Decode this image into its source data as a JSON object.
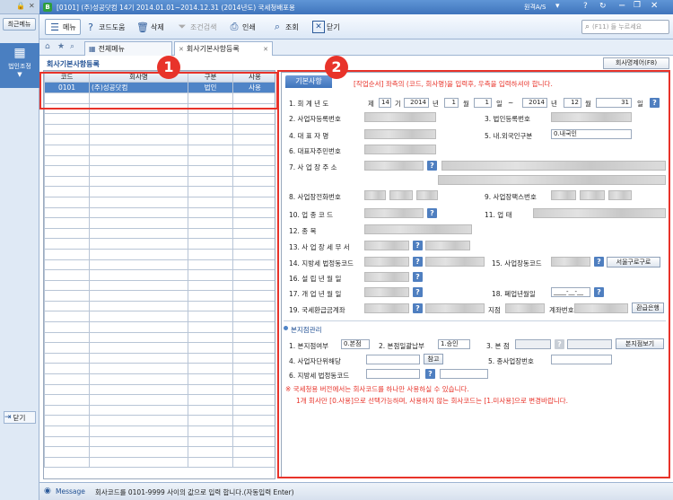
{
  "sidebar": {
    "recent_menu": "최근메뉴",
    "module_label": "법인조정",
    "close_label": "닫기"
  },
  "titlebar": {
    "title": "[0101] (주)성공닷컴  14기 2014.01.01~2014.12.31 (2014년도)  국세청배포용",
    "remote": "원격A/S"
  },
  "toolbar": {
    "menu": "메뉴",
    "help": "코드도움",
    "delete": "삭제",
    "condition": "조건검색",
    "print": "인쇄",
    "search": "조회",
    "close": "닫기",
    "search_placeholder": "(F11) 들 누르세요"
  },
  "tabs": {
    "all_menu": "전체메뉴",
    "current": "회사기본사항등록"
  },
  "page": {
    "section_title": "회사기본사항등록",
    "biz_list_button": "회사명제어(F8)"
  },
  "grid": {
    "headers": [
      "코드",
      "회사명",
      "구분",
      "사용"
    ],
    "rows": [
      {
        "code": "0101",
        "name": "(주)성공닷컴",
        "type": "법인",
        "use": "사용"
      }
    ]
  },
  "badges": {
    "one": "1",
    "two": "2"
  },
  "form": {
    "tab_label": "기본사항",
    "instruction": "[작업순서] 좌측의 (코드, 회사명)을 입력후, 우측을 입력하셔야 합니다.",
    "f1": {
      "label": "1. 회 계 년 도",
      "prefix": "제",
      "term": "14",
      "gi": "기",
      "y1": "2014",
      "nyeon": "년",
      "m1": "1",
      "wol": "월",
      "d1": "1",
      "il": "일",
      "tilde": "~",
      "y2": "2014",
      "m2": "12",
      "d2": "31"
    },
    "f2": "2. 사업자등록번호",
    "f3": "3. 법인등록번호",
    "f4": "4. 대 표 자 명",
    "f5": {
      "label": "5. 내.외국인구분",
      "value": "0.내국인"
    },
    "f6": "6. 대표자주민번호",
    "f7": "7. 사 업 장 주 소",
    "f8": "8. 사업장전화번호",
    "f9": "9. 사업장팩스번호",
    "f10": "10. 업 종 코 드",
    "f11": "11. 업 태",
    "f12": "12. 종 목",
    "f13": "13. 사 업 장 세 무 서",
    "f14": "14. 지방세 법정동코드",
    "f15": {
      "label": "15. 사업장동코드",
      "button": "서울구로구로"
    },
    "f16": "16. 설 립 년 월 일",
    "f17": "17. 개 업 년 월 일",
    "f18": {
      "label": "18. 폐업년월일",
      "value": "____-__-__"
    },
    "f19": {
      "label": "19. 국세환급금계좌",
      "branch": "지점",
      "account": "계좌번호",
      "bank_button": "환급은행"
    }
  },
  "branch": {
    "title": "본지점관리",
    "b1": {
      "label": "1. 본지점여부",
      "value": "0.본점"
    },
    "b2": {
      "label": "2. 본점일괄납부",
      "value": "1.승인"
    },
    "b3": {
      "label": "3. 본 점",
      "button": "본지점보기"
    },
    "b4": {
      "label": "4. 사업자단위해당",
      "ref": "참고"
    },
    "b5": "5. 종사업장번호",
    "b6": "6. 지방세 법정동코드",
    "warn1": "※ 국세청용 버전에서는 회사코드를 하나만 사용하실 수 있습니다.",
    "warn2": "1개 회사만 [0.사용]으로 선택가능하며, 사용하지 않는 회사코드는 [1.미사용]으로 변경바랍니다."
  },
  "status": {
    "label": "Message",
    "text": "회사코드를 0101-9999 사이의 값으로 입력 합니다.(자동입력 Enter)"
  }
}
